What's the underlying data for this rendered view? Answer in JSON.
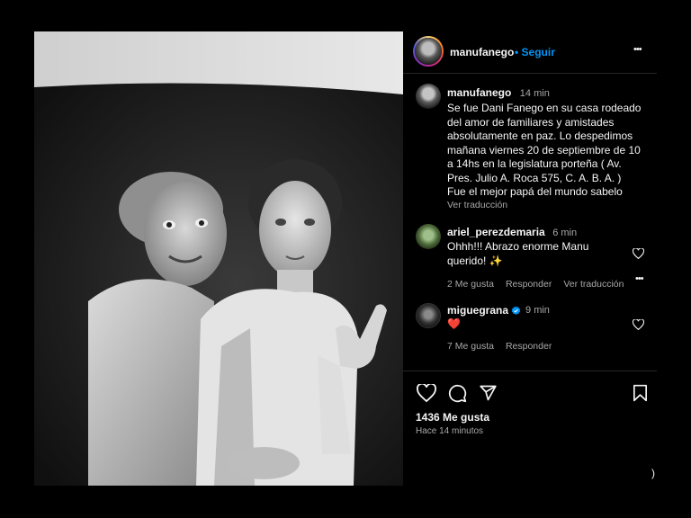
{
  "post": {
    "author": "manufanego",
    "follow_label": "• Seguir",
    "more_label": "•••"
  },
  "caption": {
    "username": "manufanego",
    "time": "14 min",
    "lines": [
      "Se fue Dani Fanego en su casa rodeado",
      "del amor de familiares y amistades",
      "absolutamente en paz. Lo despedimos",
      "mañana viernes 20 de septiembre de 10",
      "a 14hs en la legislatura porteña ( Av.",
      "Pres. Julio A. Roca 575, C. A. B. A. )",
      "Fue el mejor papá del mundo sabelo"
    ],
    "translate_label": "Ver traducción"
  },
  "comments": [
    {
      "username": "ariel_perezdemaria",
      "time": "6 min",
      "lines": [
        "Ohhh!!! Abrazo enorme Manu",
        "querido! ✨"
      ],
      "likes": "2 Me gusta",
      "reply_label": "Responder",
      "translate_label": "Ver traducción",
      "more_label": "•••"
    },
    {
      "username": "miguegrana",
      "time": "9 min",
      "text": "❤️",
      "likes": "7 Me gusta",
      "reply_label": "Responder"
    }
  ],
  "actions": {
    "likes_count": "1436 Me gusta",
    "posted_time": "Hace 14 minutos"
  },
  "icons": {
    "like": "heart-icon",
    "comment": "comment-icon",
    "share": "share-icon",
    "save": "bookmark-icon",
    "verified": "verified-badge-icon"
  },
  "colors": {
    "background": "#000000",
    "text": "#f5f5f5",
    "secondary": "#a8a8a8",
    "link": "#0095f6",
    "verified": "#0095f6",
    "heart_red": "#ff3040"
  }
}
